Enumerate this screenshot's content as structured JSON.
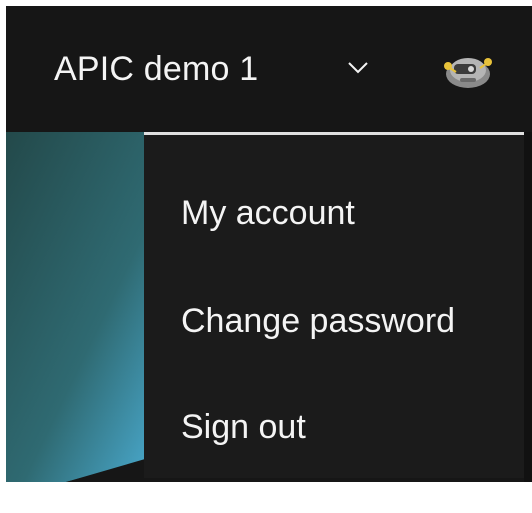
{
  "header": {
    "org_name": "APIC demo 1",
    "chevron_icon": "chevron-down-icon",
    "avatar_icon": "robot-avatar-icon"
  },
  "menu": {
    "items": [
      {
        "label": "My account"
      },
      {
        "label": "Change password"
      },
      {
        "label": "Sign out"
      }
    ]
  },
  "colors": {
    "header_bg": "#161616",
    "menu_bg": "#1b1b1b",
    "text": "#f4f4f4",
    "accent_border": "#e0e0e0",
    "gradient_start": "#2a4a4a",
    "gradient_end": "#4fb3d9"
  }
}
